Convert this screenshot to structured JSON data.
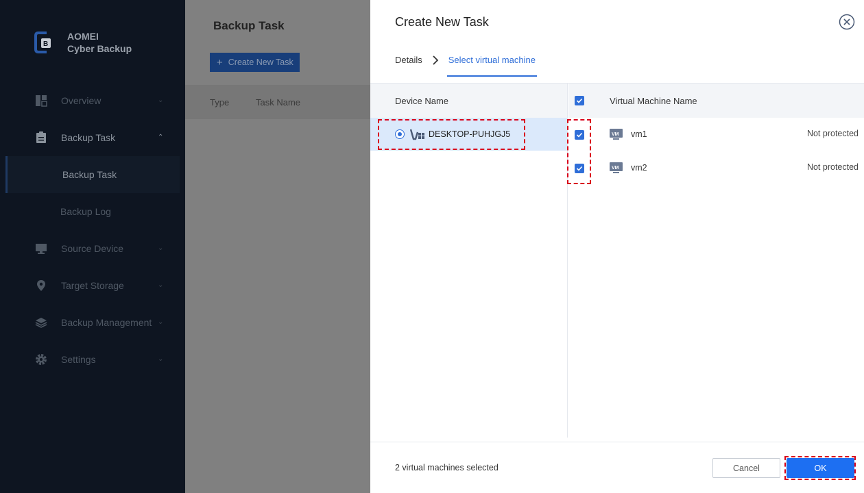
{
  "app": {
    "brand_line1": "AOMEI",
    "brand_line2": "Cyber Backup"
  },
  "sidebar": {
    "items": [
      {
        "label": "Overview",
        "icon": "overview-icon"
      },
      {
        "label": "Backup Task",
        "icon": "clipboard-icon",
        "expanded": true
      },
      {
        "label": "Backup Task",
        "sub": true,
        "selected": true
      },
      {
        "label": "Backup Log",
        "sub": true
      },
      {
        "label": "Source Device",
        "icon": "monitor-icon"
      },
      {
        "label": "Target Storage",
        "icon": "location-pin-icon"
      },
      {
        "label": "Backup Management",
        "icon": "layers-icon"
      },
      {
        "label": "Settings",
        "icon": "gear-icon"
      }
    ]
  },
  "main": {
    "title": "Backup Task",
    "create_button": "Create New Task",
    "columns": [
      "Type",
      "Task Name"
    ]
  },
  "dialog": {
    "title": "Create New Task",
    "steps": {
      "details": "Details",
      "select_vm": "Select virtual machine"
    },
    "device_pane": {
      "header": "Device Name",
      "devices": [
        {
          "name": "DESKTOP-PUHJGJ5",
          "selected": true
        }
      ]
    },
    "vm_pane": {
      "header": "Virtual Machine Name",
      "vms": [
        {
          "name": "vm1",
          "status": "Not protected",
          "checked": true,
          "badge": "VM"
        },
        {
          "name": "vm2",
          "status": "Not protected",
          "checked": true,
          "badge": "VM"
        }
      ]
    },
    "footer": {
      "selected_text": "2 virtual machines selected",
      "cancel_label": "Cancel",
      "ok_label": "OK"
    }
  },
  "colors": {
    "sidebar_bg": "#0e1521",
    "accent": "#2f6ed8",
    "ok_button": "#1d6ff2",
    "highlight": "#d9001b"
  }
}
